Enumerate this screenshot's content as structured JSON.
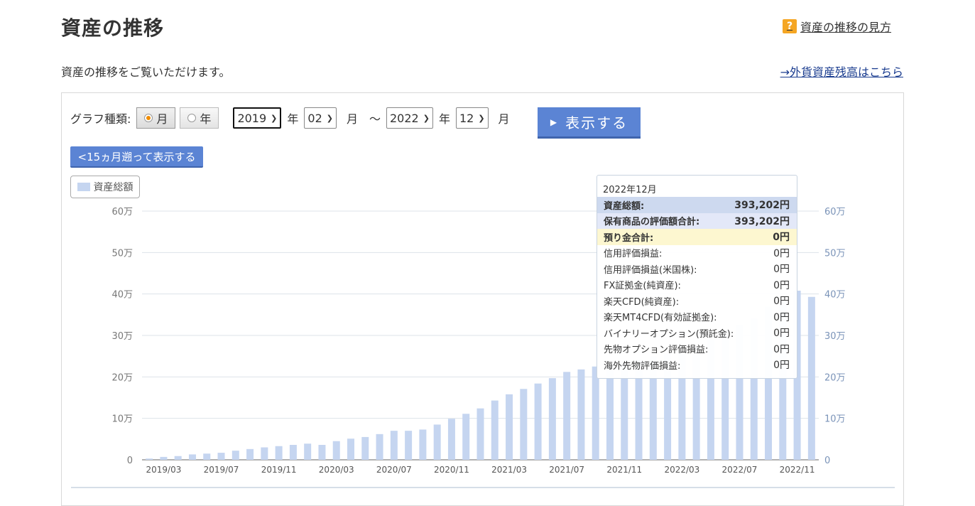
{
  "header": {
    "title": "資産の推移",
    "help_icon": "?",
    "help_link": "資産の推移の見方",
    "subtitle": "資産の推移をご覧いただけます。",
    "fx_link": "→外貨資産残高はこちら"
  },
  "controls": {
    "graph_type_label": "グラフ種類:",
    "type_month": "月",
    "type_year": "年",
    "selected_type": "月",
    "start_year": "2019",
    "start_month": "02",
    "end_year": "2022",
    "end_month": "12",
    "unit_year": "年",
    "unit_month": "月",
    "range_sep": "〜",
    "show_button": "表示する",
    "back_button": "<15ヵ月遡って表示する"
  },
  "colors": {
    "bar": "#c5d5f0",
    "bar_highlight": "#dfe8f7",
    "accent": "#5b84d4"
  },
  "chart_data": {
    "type": "bar",
    "legend": [
      "資産総額"
    ],
    "y_unit": "万",
    "ylim": [
      0,
      60
    ],
    "yticks": [
      "0",
      "10万",
      "20万",
      "30万",
      "40万",
      "50万",
      "60万"
    ],
    "xtick_labels": [
      "2019/03",
      "2019/07",
      "2019/11",
      "2020/03",
      "2020/07",
      "2020/11",
      "2021/03",
      "2021/07",
      "2021/11",
      "2022/03",
      "2022/07",
      "2022/11"
    ],
    "categories": [
      "2019/02",
      "2019/03",
      "2019/04",
      "2019/05",
      "2019/06",
      "2019/07",
      "2019/08",
      "2019/09",
      "2019/10",
      "2019/11",
      "2019/12",
      "2020/01",
      "2020/02",
      "2020/03",
      "2020/04",
      "2020/05",
      "2020/06",
      "2020/07",
      "2020/08",
      "2020/09",
      "2020/10",
      "2020/11",
      "2020/12",
      "2021/01",
      "2021/02",
      "2021/03",
      "2021/04",
      "2021/05",
      "2021/06",
      "2021/07",
      "2021/08",
      "2021/09",
      "2021/10",
      "2021/11",
      "2021/12",
      "2022/01",
      "2022/02",
      "2022/03",
      "2022/04",
      "2022/05",
      "2022/06",
      "2022/07",
      "2022/08",
      "2022/09",
      "2022/10",
      "2022/11",
      "2022/12"
    ],
    "values": [
      0.3,
      0.7,
      0.9,
      1.3,
      1.5,
      1.7,
      2.2,
      2.6,
      3.0,
      3.3,
      3.6,
      3.9,
      3.6,
      4.5,
      5.1,
      5.5,
      6.2,
      7.0,
      7.0,
      7.3,
      8.5,
      9.9,
      11.1,
      12.4,
      14.3,
      15.8,
      17.1,
      18.4,
      19.7,
      21.2,
      21.8,
      22.5,
      23.0,
      23.5,
      24.2,
      25.0,
      25.6,
      26.3,
      27.4,
      29.0,
      31.4,
      32.5,
      34.0,
      36.9,
      38.5,
      40.8,
      39.3
    ]
  },
  "tooltip": {
    "title": "2022年12月",
    "rows": [
      {
        "label": "資産総額:",
        "value": "393,202円"
      },
      {
        "label": "保有商品の評価額合計:",
        "value": "393,202円"
      },
      {
        "label": "預り金合計:",
        "value": "0円"
      },
      {
        "label": "信用評価損益:",
        "value": "0円"
      },
      {
        "label": "信用評価損益(米国株):",
        "value": "0円"
      },
      {
        "label": "FX証拠金(純資産):",
        "value": "0円"
      },
      {
        "label": "楽天CFD(純資産):",
        "value": "0円"
      },
      {
        "label": "楽天MT4CFD(有効証拠金):",
        "value": "0円"
      },
      {
        "label": "バイナリーオプション(預託金):",
        "value": "0円"
      },
      {
        "label": "先物オプション評価損益:",
        "value": "0円"
      },
      {
        "label": "海外先物評価損益:",
        "value": "0円"
      }
    ]
  }
}
